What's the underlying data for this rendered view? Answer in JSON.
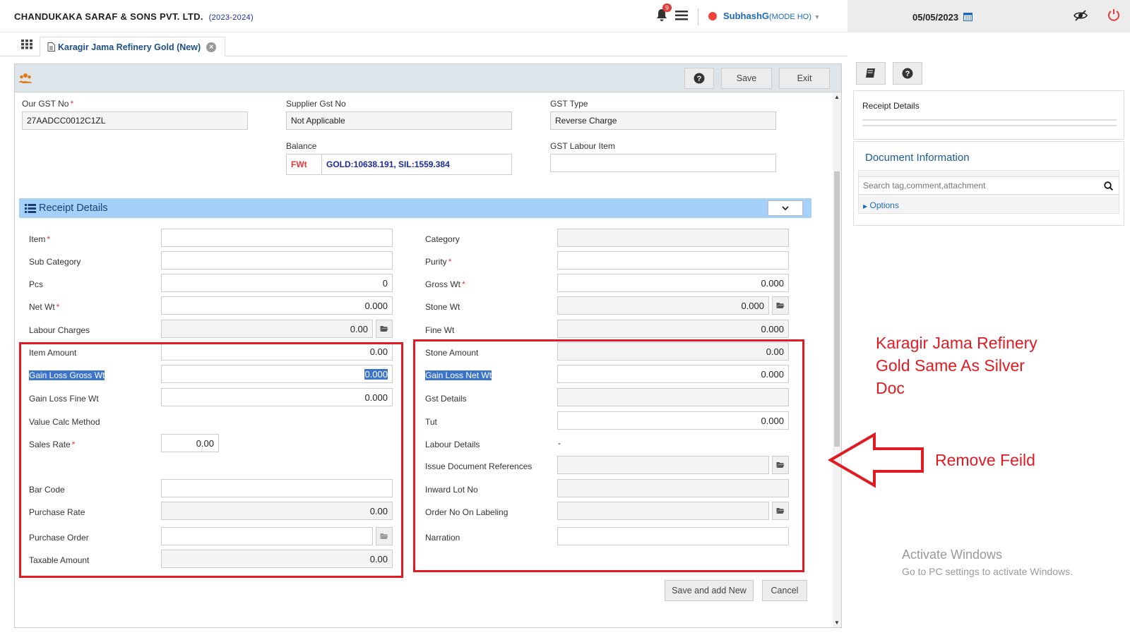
{
  "header": {
    "company": "CHANDUKAKA SARAF & SONS PVT. LTD.",
    "year": "(2023-2024)",
    "notif_count": "9",
    "user_name": "SubhashG",
    "user_mode": "(MODE HO)",
    "date": "05/05/2023"
  },
  "tab": {
    "label": "Karagir Jama Refinery Gold (New)"
  },
  "toolbar": {
    "save_label": "Save",
    "exit_label": "Exit"
  },
  "gst": {
    "our_gst_label": "Our GST No",
    "our_gst_value": "27AADCC0012C1ZL",
    "supplier_label": "Supplier Gst No",
    "supplier_value": "Not Applicable",
    "type_label": "GST Type",
    "type_value": "Reverse Charge",
    "balance_label": "Balance",
    "balance_tag": "FWt",
    "balance_value": "GOLD:10638.191, SIL:1559.384",
    "labour_item_label": "GST Labour Item"
  },
  "receipt": {
    "title": "Receipt Details",
    "item_label": "Item",
    "subcategory_label": "Sub Category",
    "pcs_label": "Pcs",
    "pcs_value": "0",
    "netwt_label": "Net Wt",
    "netwt_value": "0.000",
    "labour_label": "Labour Charges",
    "labour_value": "0.00",
    "item_amount_label": "Item Amount",
    "item_amount_value": "0.00",
    "gl_gross_label": "Gain Loss Gross Wt",
    "gl_gross_value": "0.000",
    "gl_fine_label": "Gain Loss Fine Wt",
    "gl_fine_value": "0.000",
    "value_calc_label": "Value Calc Method",
    "sales_rate_label": "Sales Rate",
    "sales_rate_value": "0.00",
    "barcode_label": "Bar Code",
    "purchase_rate_label": "Purchase Rate",
    "purchase_rate_value": "0.00",
    "purchase_order_label": "Purchase Order",
    "taxable_label": "Taxable Amount",
    "taxable_value": "0.00",
    "category_label": "Category",
    "purity_label": "Purity",
    "grosswt_label": "Gross Wt",
    "grosswt_value": "0.000",
    "stonewt_label": "Stone Wt",
    "stonewt_value": "0.000",
    "finewt_label": "Fine Wt",
    "finewt_value": "0.000",
    "stone_amount_label": "Stone Amount",
    "stone_amount_value": "0.00",
    "gl_net_label": "Gain Loss Net Wt",
    "gl_net_value": "0.000",
    "gst_details_label": "Gst Details",
    "tut_label": "Tut",
    "tut_value": "0.000",
    "labour_details_label": "Labour Details",
    "labour_details_value": "-",
    "issue_doc_label": "Issue Document References",
    "inward_lot_label": "Inward Lot No",
    "order_no_label": "Order No On Labeling",
    "narration_label": "Narration",
    "save_add_label": "Save and add New",
    "cancel_label": "Cancel"
  },
  "right_panel": {
    "receipt_details": "Receipt Details",
    "doc_info": "Document Information",
    "search_placeholder": "Search tag,comment,attachment",
    "options": "Options"
  },
  "annotations": {
    "note1_line1": "Karagir Jama Refinery",
    "note1_line2": "Gold Same As Silver",
    "note1_line3": "Doc",
    "note2": "Remove Feild"
  },
  "watermark": {
    "title": "Activate Windows",
    "subtitle": "Go to PC settings to activate Windows."
  },
  "colors": {
    "accent": "#1c69b5",
    "section": "#a5d0fa",
    "annotation": "#e01b24"
  }
}
